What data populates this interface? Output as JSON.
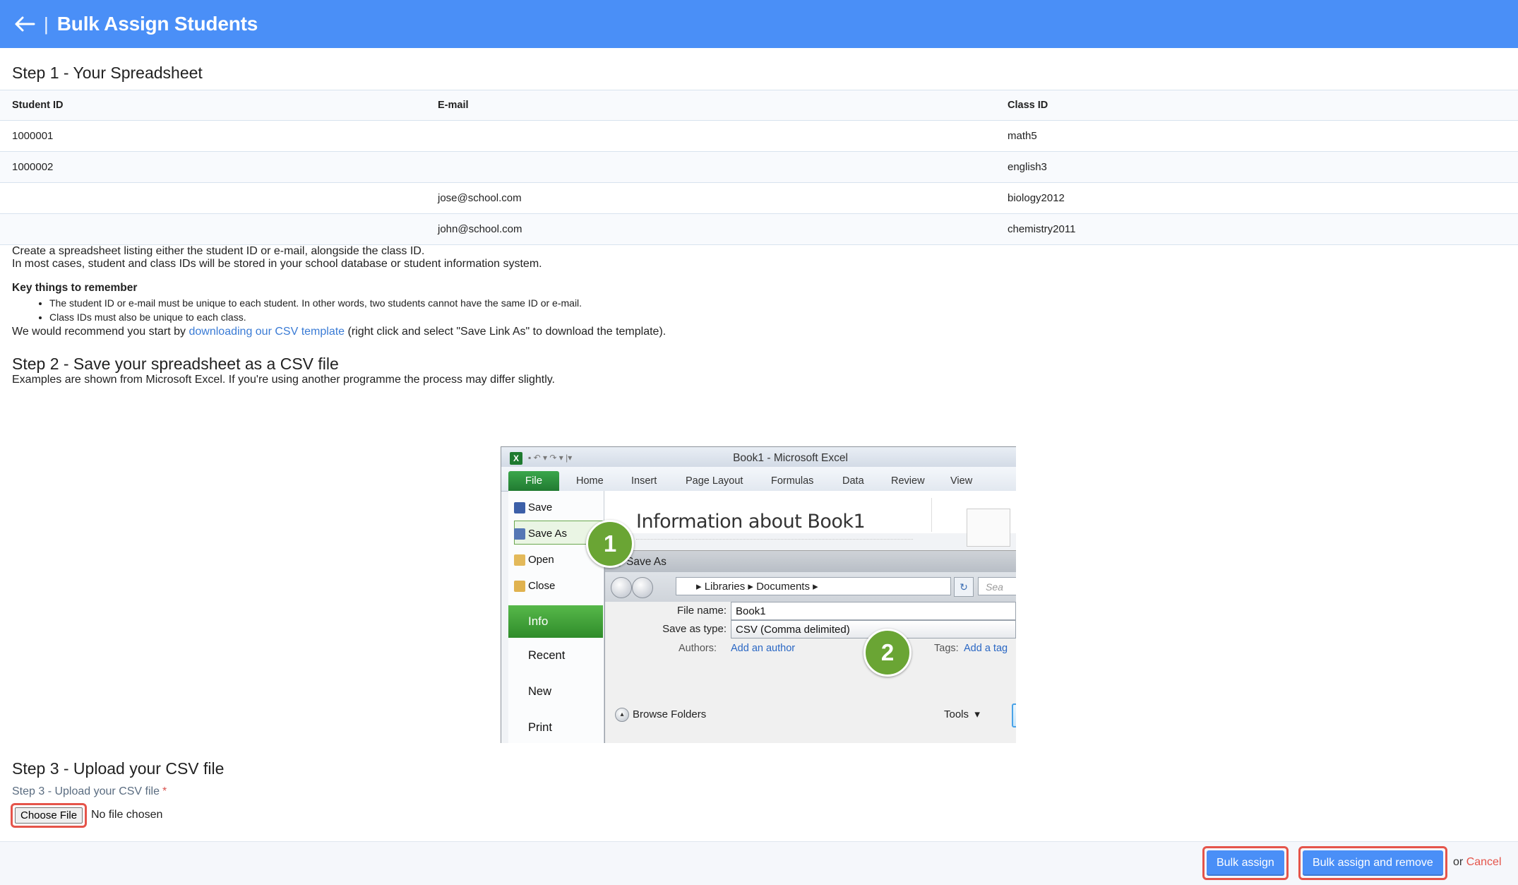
{
  "header": {
    "title": "Bulk Assign Students",
    "back_icon": "arrow-left-icon",
    "separator": "|"
  },
  "step1": {
    "title": "Step 1 - Your Spreadsheet",
    "table": {
      "columns": [
        "Student ID",
        "E-mail",
        "Class ID"
      ],
      "rows": [
        [
          "1000001",
          "",
          "math5"
        ],
        [
          "1000002",
          "",
          "english3"
        ],
        [
          "",
          "jose@school.com",
          "biology2012"
        ],
        [
          "",
          "john@school.com",
          "chemistry2011"
        ]
      ]
    },
    "para1": "Create a spreadsheet listing either the student ID or e-mail, alongside the class ID.",
    "para2": "In most cases, student and class IDs will be stored in your school database or student information system.",
    "key_title": "Key things to remember",
    "key_items": [
      "The student ID or e-mail must be unique to each student. In other words, two students cannot have the same ID or e-mail.",
      "Class IDs must also be unique to each class."
    ],
    "recommend_prefix": "We would recommend you start by ",
    "recommend_link": "downloading our CSV template",
    "recommend_suffix": " (right click and select \"Save Link As\" to download the template)."
  },
  "step2": {
    "title": "Step 2 - Save your spreadsheet as a CSV file",
    "description": "Examples are shown from Microsoft Excel. If you're using another programme the process may differ slightly.",
    "excel": {
      "window_title": "Book1  -  Microsoft Excel",
      "file_tab": "File",
      "tabs": [
        "Home",
        "Insert",
        "Page Layout",
        "Formulas",
        "Data",
        "Review",
        "View"
      ],
      "menu": [
        "Save",
        "Save As",
        "Open",
        "Close"
      ],
      "menu_sections": [
        "Info",
        "Recent",
        "New",
        "Print"
      ],
      "info_title": "Information about Book1",
      "dialog_title": "Save As",
      "breadcrumb": "▸  Libraries  ▸  Documents  ▸",
      "search_placeholder": "Sea",
      "file_name_label": "File name:",
      "file_name_value": "Book1",
      "save_type_label": "Save as type:",
      "save_type_value": "CSV (Comma delimited)",
      "authors_label": "Authors:",
      "authors_value": "Add an author",
      "tags_label": "Tags:",
      "tags_value": "Add a tag",
      "browse_folders": "Browse Folders",
      "tools": "Tools",
      "badge1": "1",
      "badge2": "2"
    }
  },
  "step3": {
    "title": "Step 3 - Upload your CSV file",
    "field_label": "Step 3 - Upload your CSV file",
    "required_mark": "*",
    "choose_file": "Choose File",
    "no_file": "No file chosen"
  },
  "footer": {
    "bulk_assign": "Bulk assign",
    "bulk_assign_remove": "Bulk assign and remove",
    "or": "or",
    "cancel": "Cancel"
  },
  "colors": {
    "header_bg": "#4a8ff7",
    "highlight": "#e5544a",
    "link": "#3a7bd5",
    "excel_green": "#2f8c2a"
  }
}
